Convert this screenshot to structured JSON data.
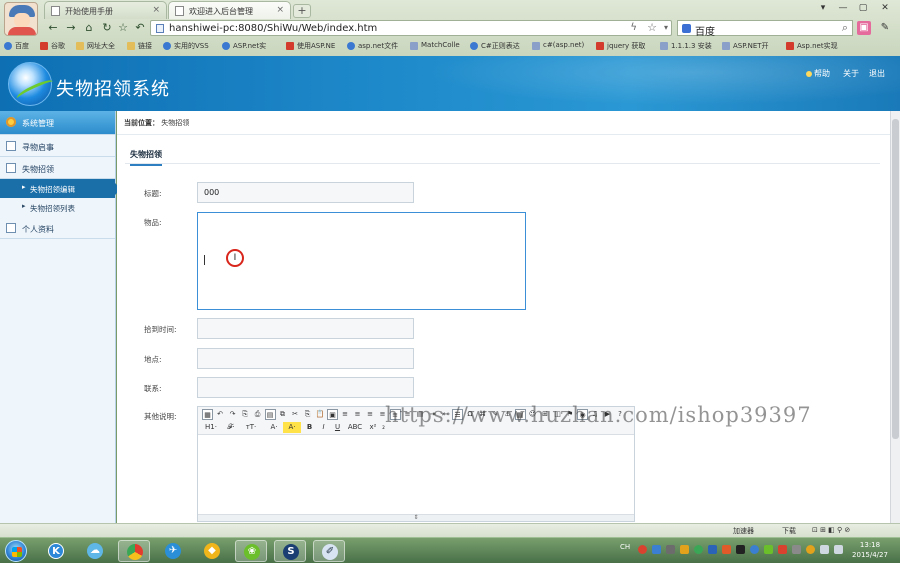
{
  "browser": {
    "tabs": [
      {
        "label": "开始使用手册",
        "active": false
      },
      {
        "label": "欢迎进入后台管理",
        "active": true
      }
    ],
    "new_tab_label": "+",
    "window_controls": [
      "▾",
      "—",
      "▢",
      "✕"
    ],
    "url": "hanshiwei-pc:8080/ShiWu/Web/index.htm",
    "search_engine": "百度",
    "bookmarks": [
      {
        "label": "百度",
        "style": "blue"
      },
      {
        "label": "谷歌",
        "style": "red"
      },
      {
        "label": "网址大全",
        "style": "folder"
      },
      {
        "label": "链接",
        "style": "folder"
      },
      {
        "label": "实用的VSS",
        "style": "blue"
      },
      {
        "label": "ASP.net实",
        "style": "blue"
      },
      {
        "label": "使用ASP.NE",
        "style": "red"
      },
      {
        "label": "asp.net文件",
        "style": "blue"
      },
      {
        "label": "MatchColle",
        "style": "plain"
      },
      {
        "label": "C#正则表达",
        "style": "blue"
      },
      {
        "label": "c#(asp.net)",
        "style": "plain"
      },
      {
        "label": "jquery 获取",
        "style": "red"
      },
      {
        "label": "1.1.1.3 安装",
        "style": "plain"
      },
      {
        "label": "ASP.NET开",
        "style": "plain"
      },
      {
        "label": "Asp.net实现",
        "style": "red"
      }
    ]
  },
  "app": {
    "title": "失物招领系统",
    "header_links": [
      "帮助",
      "关于",
      "退出"
    ]
  },
  "sidebar": {
    "top": "系统管理",
    "sections": [
      {
        "label": "寻物启事",
        "subitems": []
      },
      {
        "label": "失物招领",
        "subitems": [
          {
            "label": "失物招领编辑",
            "active": true
          },
          {
            "label": "失物招领列表",
            "active": false
          }
        ]
      },
      {
        "label": "个人资料",
        "subitems": []
      }
    ]
  },
  "main": {
    "breadcrumb_label": "当前位置：",
    "breadcrumb_value": "失物招领",
    "section_title": "失物招领",
    "form": {
      "title_label": "标题:",
      "title_value": "000",
      "item_label": "物品:",
      "found_time_label": "拾到时间:",
      "location_label": "地点:",
      "contact_label": "联系:",
      "description_label": "其他说明:"
    },
    "editor_toolbar": {
      "row1": [
        "▦",
        "↶",
        "↷",
        "⎘",
        "⎙",
        "▤",
        "⧉",
        "✂",
        "⎘",
        "📋",
        "▣",
        "≡",
        "≡",
        "≡",
        "≡",
        "≡",
        "≡",
        "▤",
        "⇥",
        "⇤",
        "☰",
        "Ω",
        "⌘",
        "✎",
        "⚓",
        "▦",
        "☺",
        "⊞",
        "◫",
        "⚑",
        "◉",
        "♫",
        "▶",
        "?"
      ],
      "row2": [
        "H1·",
        "𝓕·",
        "тT·",
        "A·",
        "A·",
        "B",
        "I",
        "U",
        "ABC",
        "x²",
        "₂"
      ]
    },
    "editor_footer": "⇕"
  },
  "watermark": "https://www.huzhan.com/ishop39397",
  "statusbar": {
    "accelerator": "加速器",
    "downloads": "下载"
  },
  "taskbar": {
    "clock_time": "13:18",
    "clock_date": "2015/4/27",
    "tray_lang": "CH"
  }
}
